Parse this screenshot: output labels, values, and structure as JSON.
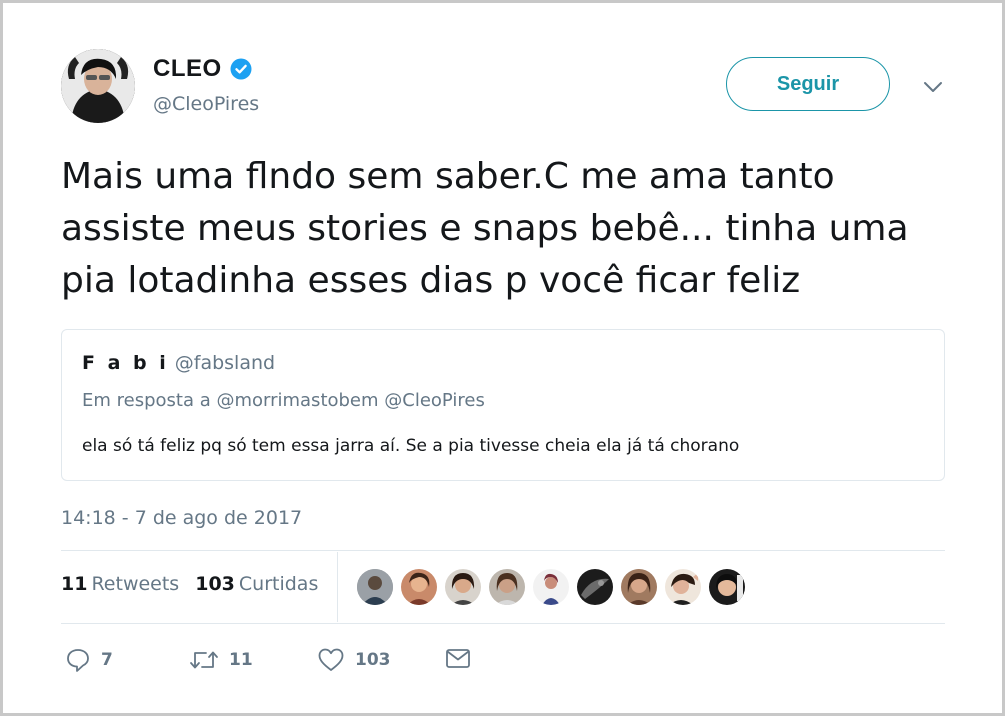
{
  "user": {
    "display_name": "CLEO",
    "handle": "@CleoPires",
    "verified": true
  },
  "follow_button": {
    "label": "Seguir"
  },
  "tweet": {
    "text": "Mais uma flndo sem saber.C me ama tanto assiste meus stories e snaps bebê... tinha uma pia lotadinha esses dias p você ficar feliz",
    "timestamp": "14:18 - 7 de ago de 2017"
  },
  "quoted_tweet": {
    "name": "F a b i",
    "handle": "@fabsland",
    "reply_context": "Em resposta a @morrimastobem @CleoPires",
    "text": "ela só tá feliz pq só tem essa jarra aí. Se a pia tivesse cheia ela já tá chorano"
  },
  "stats": {
    "retweets_count": "11",
    "retweets_label": "Retweets",
    "likes_count": "103",
    "likes_label": "Curtidas"
  },
  "actions": {
    "reply_count": "7",
    "retweet_count": "11",
    "like_count": "103"
  },
  "colors": {
    "accent": "#1b95a8",
    "verified": "#1da1f2",
    "secondary_text": "#657786",
    "border": "#e1e8ed"
  },
  "icons": [
    "verified-badge-icon",
    "chevron-down-icon",
    "reply-icon",
    "retweet-icon",
    "heart-icon",
    "message-icon"
  ]
}
